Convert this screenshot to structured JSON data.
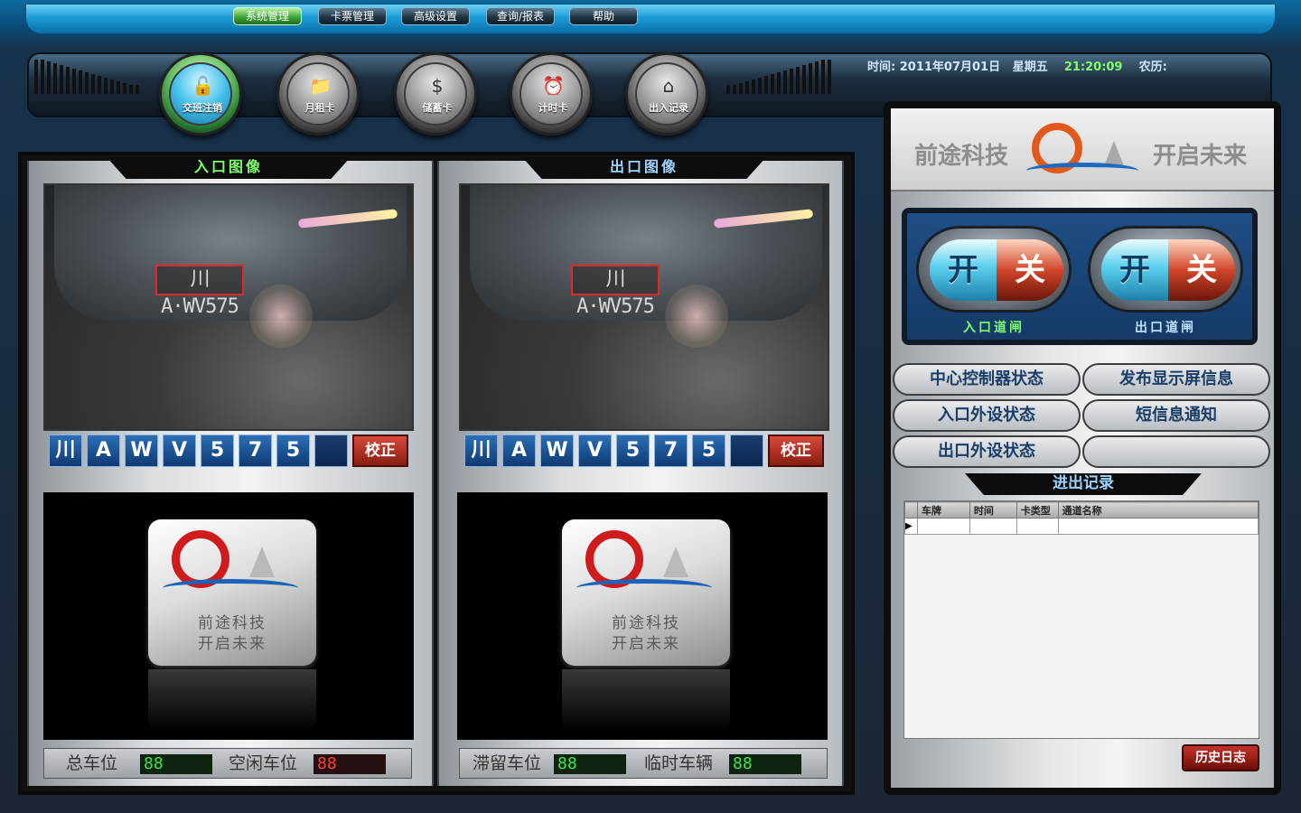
{
  "menu": {
    "items": [
      "系统管理",
      "卡票管理",
      "高级设置",
      "查询/报表",
      "帮助"
    ]
  },
  "toolbar": {
    "buttons": [
      {
        "label": "交班注销",
        "icon": "unlock-icon"
      },
      {
        "label": "月租卡",
        "icon": "folder-icon"
      },
      {
        "label": "储蓄卡",
        "icon": "money-icon"
      },
      {
        "label": "计时卡",
        "icon": "clock-icon"
      },
      {
        "label": "出入记录",
        "icon": "home-icon"
      }
    ]
  },
  "datetime": {
    "time_label": "时间:",
    "date": "2011年07月01日",
    "weekday": "星期五",
    "clock": "21:20:09",
    "lunar_label": "农历:"
  },
  "entry": {
    "title": "入口图像",
    "plate_image_text": "川A·WV575",
    "plate_chars": [
      "川",
      "A",
      "W",
      "V",
      "5",
      "7",
      "5",
      ""
    ],
    "fix_label": "校正"
  },
  "exit": {
    "title": "出口图像",
    "plate_image_text": "川A·WV575",
    "plate_chars": [
      "川",
      "A",
      "W",
      "V",
      "5",
      "7",
      "5",
      ""
    ],
    "fix_label": "校正"
  },
  "logo_card": {
    "line1": "前途科技",
    "line2": "开启未来"
  },
  "stats": {
    "total_label": "总车位",
    "total_value": "88",
    "free_label": "空闲车位",
    "free_value": "88",
    "stay_label": "滞留车位",
    "stay_value": "88",
    "temp_label": "临时车辆",
    "temp_value": "88"
  },
  "brand": {
    "left": "前途科技",
    "right": "开启未来"
  },
  "gates": {
    "on": "开",
    "off": "关",
    "entry_label": "入口道闸",
    "exit_label": "出口道闸"
  },
  "controls": {
    "center_status": "中心控制器状态",
    "publish_display": "发布显示屏信息",
    "entry_device_status": "入口外设状态",
    "sms_notify": "短信息通知",
    "exit_device_status": "出口外设状态"
  },
  "records": {
    "title": "进出记录",
    "columns": [
      "车牌",
      "时间",
      "卡类型",
      "通道名称"
    ],
    "history_button": "历史日志"
  },
  "colors": {
    "menu_active": "#3fa63a",
    "led_green": "#3ee34a",
    "led_red": "#ff3b3b",
    "entry_title": "#7dff6a",
    "exit_title": "#9fd3ff"
  }
}
